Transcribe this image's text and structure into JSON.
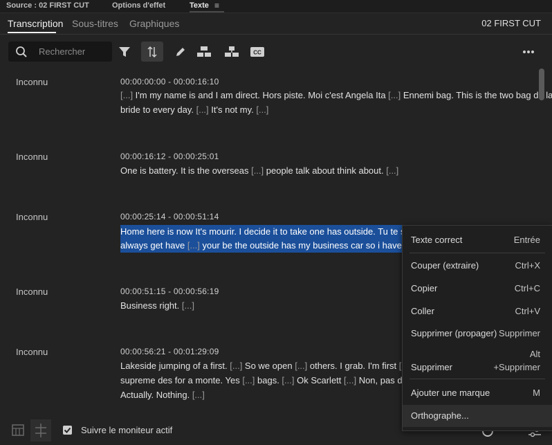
{
  "panel_tabs": {
    "source": "Source : 02 FIRST CUT",
    "effects": "Options d'effet",
    "text": "Texte",
    "menu_icon": "hamburger-icon"
  },
  "sub_tabs": {
    "transcription": "Transcription",
    "subtitles": "Sous-titres",
    "graphics": "Graphiques"
  },
  "sequence_name": "02 FIRST CUT",
  "search": {
    "placeholder": "Rechercher",
    "value": ""
  },
  "toolbar": {
    "icons": [
      "filter-icon",
      "sync-icon",
      "pencil-icon",
      "merge-icon",
      "split-icon",
      "captions-icon",
      "more-icon"
    ]
  },
  "segments": [
    {
      "speaker": "Inconnu",
      "timecode": "00:00:00:00 - 00:00:16:10",
      "lines": [
        "[...] I'm my name is and I am direct. Hors piste. Moi c'est Angela Ita [...] Ennemi bag. This is the two bag de la",
        "bride to every day. [...] It's not my. [...]"
      ]
    },
    {
      "speaker": "Inconnu",
      "timecode": "00:00:16:12 - 00:00:25:01",
      "lines": [
        "One is battery. It is the overseas [...] people talk about think about. [...]"
      ]
    },
    {
      "speaker": "Inconnu",
      "timecode": "00:00:25:14 - 00:00:51:14",
      "lines": [
        "Home here is now It's mourir. I decide it to take one has outside. Tu te so [...",
        "always get have [...] your be the outside has my business car so i have ther"
      ]
    },
    {
      "speaker": "Inconnu",
      "timecode": "00:00:51:15 - 00:00:56:19",
      "lines": [
        "Business right. [...]"
      ]
    },
    {
      "speaker": "Inconnu",
      "timecode": "00:00:56:21 - 00:01:29:09",
      "lines": [
        "Lakeside jumping of a first. [...] So we open [...] others. I grab. I'm first [...] s",
        "supreme des for a monte. Yes [...] bags. [...] Ok Scarlett [...] Non, pas devan",
        "Actually. Nothing. [...]"
      ]
    }
  ],
  "context_menu": [
    {
      "label": "Texte correct",
      "key": "Entrée"
    },
    {
      "label": "Couper (extraire)",
      "key": "Ctrl+X"
    },
    {
      "label": "Copier",
      "key": "Ctrl+C"
    },
    {
      "label": "Coller",
      "key": "Ctrl+V"
    },
    {
      "label": "Supprimer (propager)",
      "key": "Supprimer"
    },
    {
      "label": "Supprimer",
      "key_line1": "Alt",
      "key_line2": "+Supprimer"
    },
    {
      "label": "Ajouter une marque",
      "key": "M"
    },
    {
      "label": "Orthographe..."
    }
  ],
  "bottom": {
    "follow_label": "Suivre le moniteur actif",
    "follow_checked": true,
    "zoom_level": 0.35
  },
  "colors": {
    "highlight": "#1b4f9a",
    "background": "#232323",
    "underline": "#c84b4b"
  }
}
